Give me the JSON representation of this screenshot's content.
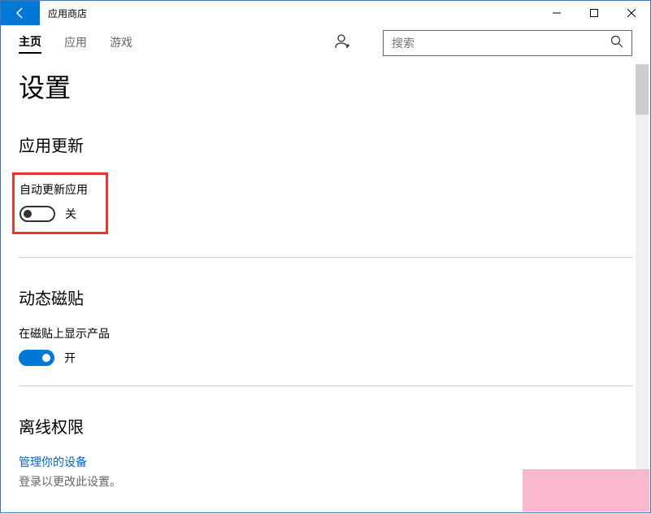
{
  "titlebar": {
    "app_name": "应用商店"
  },
  "nav": {
    "items": [
      "主页",
      "应用",
      "游戏"
    ],
    "active_index": 0
  },
  "search": {
    "placeholder": "搜索"
  },
  "page_title": "设置",
  "sections": {
    "app_updates": {
      "title": "应用更新",
      "setting_label": "自动更新应用",
      "toggle_state": "关"
    },
    "live_tile": {
      "title": "动态磁贴",
      "setting_label": "在磁贴上显示产品",
      "toggle_state": "开"
    },
    "offline": {
      "title": "离线权限",
      "link": "管理你的设备",
      "info": "登录以更改此设置。"
    }
  }
}
